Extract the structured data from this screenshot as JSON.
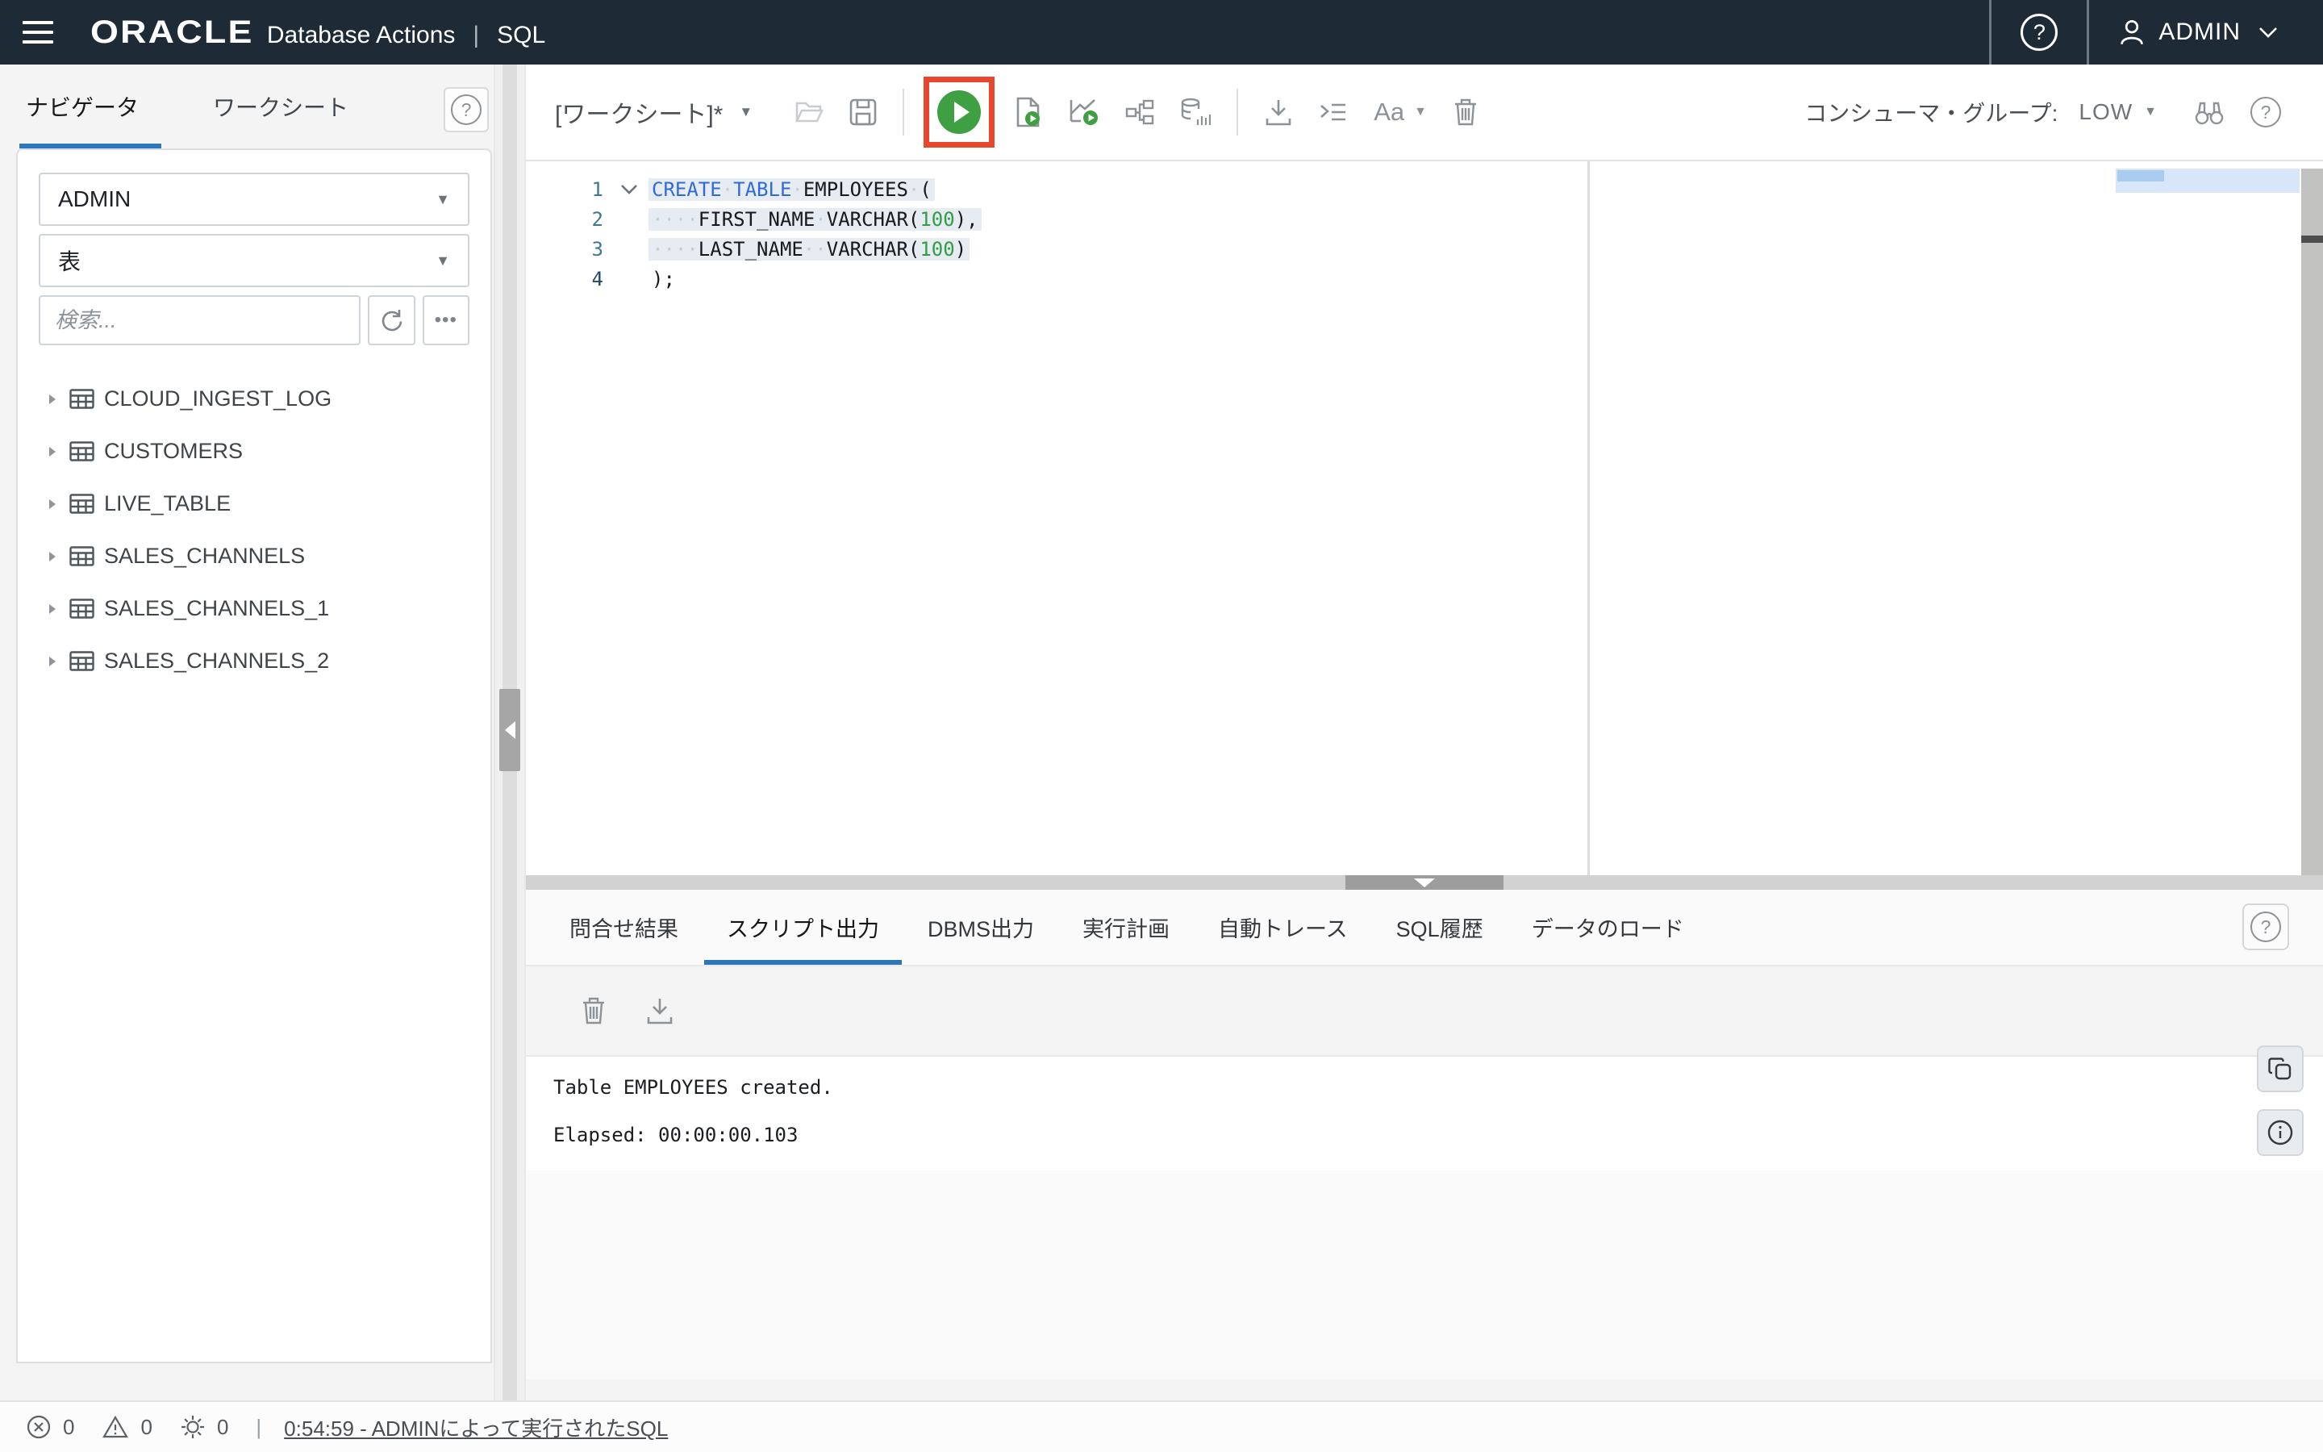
{
  "colors": {
    "topbar_bg": "#1f2a37",
    "accent_blue": "#2c77b8",
    "run_green": "#3f9f43",
    "annotation_red": "#e8462d",
    "keyword_blue": "#2f6bd8",
    "number_green": "#2f9e44",
    "selection_bg": "#e7ecf2"
  },
  "topbar": {
    "brand": "ORACLE",
    "reg": "®",
    "product": "Database Actions",
    "divider": "|",
    "app": "SQL",
    "help": "?",
    "user": "ADMIN"
  },
  "sidebar": {
    "tab_navigator": "ナビゲータ",
    "tab_worksheet": "ワークシート",
    "help": "?",
    "schema": "ADMIN",
    "object_type": "表",
    "search_placeholder": "検索...",
    "more": "•••",
    "dropdown_arrow": "▼",
    "tree": [
      {
        "label": "CLOUD_INGEST_LOG"
      },
      {
        "label": "CUSTOMERS"
      },
      {
        "label": "LIVE_TABLE"
      },
      {
        "label": "SALES_CHANNELS"
      },
      {
        "label": "SALES_CHANNELS_1"
      },
      {
        "label": "SALES_CHANNELS_2"
      }
    ]
  },
  "toolbar": {
    "worksheet_name": "[ワークシート]*",
    "dropdown_arrow": "▼",
    "aa": "Aa",
    "consumer_group_label": "コンシューマ・グループ:",
    "consumer_group_value": "LOW",
    "help": "?"
  },
  "editor": {
    "line_numbers": [
      "1",
      "2",
      "3",
      "4"
    ],
    "code": {
      "l1": {
        "kw1": "CREATE",
        "sep1": "·",
        "kw2": "TABLE",
        "sep2": "·",
        "id": "EMPLOYEES",
        "sep3": "·",
        "paren": "("
      },
      "l2": {
        "indent": "····",
        "id": "FIRST_NAME",
        "sep": "·",
        "type": "VARCHAR(",
        "size": "100",
        "close": "),"
      },
      "l3": {
        "indent": "····",
        "id": "LAST_NAME",
        "sep": "··",
        "type": "VARCHAR(",
        "size": "100",
        "close": ")"
      },
      "l4": {
        "text": ");"
      }
    }
  },
  "bottom": {
    "tabs": [
      {
        "label": "問合せ結果"
      },
      {
        "label": "スクリプト出力"
      },
      {
        "label": "DBMS出力"
      },
      {
        "label": "実行計画"
      },
      {
        "label": "自動トレース"
      },
      {
        "label": "SQL履歴"
      },
      {
        "label": "データのロード"
      }
    ],
    "help": "?",
    "output_line1": "Table EMPLOYEES created.",
    "output_line2": "Elapsed: 00:00:00.103"
  },
  "statusbar": {
    "errors": "0",
    "warnings": "0",
    "tasks": "0",
    "divider": "|",
    "link": "0:54:59 - ADMINによって実行されたSQL"
  }
}
